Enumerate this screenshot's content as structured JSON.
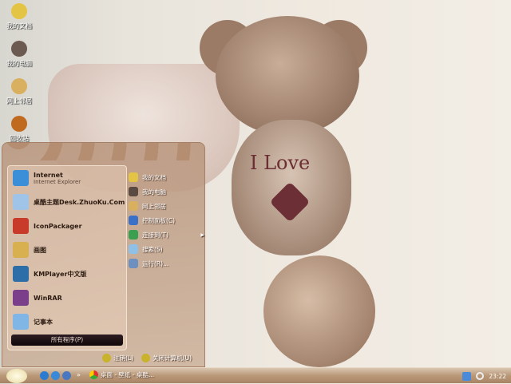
{
  "desktop_icons": [
    {
      "label": "我的文档",
      "icon": "lion-icon",
      "color": "#e4c445"
    },
    {
      "label": "我的电脑",
      "icon": "bear-icon",
      "color": "#6c5a50"
    },
    {
      "label": "网上邻居",
      "icon": "cat-icon",
      "color": "#d8b060"
    },
    {
      "label": "回收站",
      "icon": "lion-brown-icon",
      "color": "#c06a20"
    }
  ],
  "wallpaper": {
    "text": "I Love"
  },
  "start_menu": {
    "programs": [
      {
        "label": "Internet",
        "sub": "Internet Explorer",
        "icon": "ie-icon",
        "color": "#3a8fd8"
      },
      {
        "label": "桌酷主题Desk.ZhuoKu.Com",
        "icon": "zhuoku-icon",
        "color": "#9fc4e8"
      },
      {
        "label": "IconPackager",
        "icon": "iconpackager-icon",
        "color": "#c83a2a"
      },
      {
        "label": "画图",
        "icon": "paint-icon",
        "color": "#d9b050"
      },
      {
        "label": "KMPlayer中文版",
        "icon": "kmplayer-icon",
        "color": "#2d6ea8"
      },
      {
        "label": "WinRAR",
        "icon": "winrar-icon",
        "color": "#7a3e8a"
      },
      {
        "label": "记事本",
        "icon": "notepad-icon",
        "color": "#7fb6e6"
      }
    ],
    "all_programs": "所有程序(P)",
    "places": [
      {
        "label": "我的文档",
        "icon": "lion-icon",
        "color": "#e4c445"
      },
      {
        "label": "我的电脑",
        "icon": "bear-icon",
        "color": "#5a4a42"
      },
      {
        "label": "网上邻居",
        "icon": "cat-icon",
        "color": "#d8b060"
      },
      {
        "label": "控制面板(C)",
        "icon": "control-panel-icon",
        "color": "#3a70c8"
      },
      {
        "label": "连接到(T)",
        "icon": "globe-icon",
        "color": "#3aa050",
        "submenu": "▶"
      },
      {
        "label": "搜索(S)",
        "icon": "search-icon",
        "color": "#8fc0e8"
      },
      {
        "label": "运行(R)...",
        "icon": "run-icon",
        "color": "#6d90c0"
      }
    ],
    "logoff": "注销(L)",
    "shutdown": "关闭计算机(U)"
  },
  "taskbar": {
    "quick_launch": [
      {
        "icon": "ie-icon",
        "color": "#2a7cd0"
      },
      {
        "icon": "media-player-icon",
        "color": "#3a88d8"
      },
      {
        "icon": "desktop-icon",
        "color": "#4a78c0"
      }
    ],
    "chevron": "»",
    "task_label": "桌面 - 壁纸 - 桌酷...",
    "clock": "23:22"
  }
}
